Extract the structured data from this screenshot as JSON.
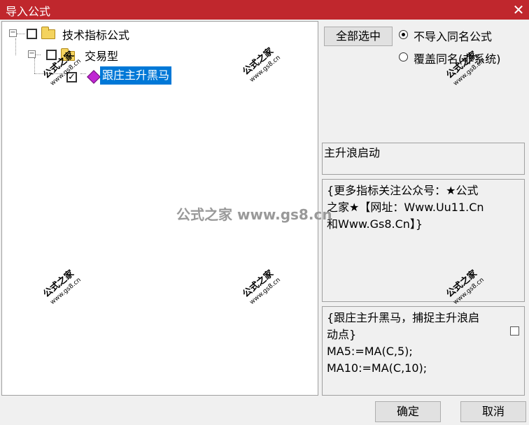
{
  "window": {
    "title": "导入公式",
    "close_glyph": "✕"
  },
  "tree": {
    "root_label": "技术指标公式",
    "group_label": "交易型",
    "item_label": "跟庄主升黑马",
    "item_checked": "✓"
  },
  "options": {
    "select_all_label": "全部选中",
    "radio_no_import": "不导入同名公式",
    "radio_overwrite": "覆盖同名(非系统)"
  },
  "panels": {
    "name_text": "主升浪启动",
    "desc_text": "{更多指标关注公众号：★公式\n之家★【网址：Www.Uu11.Cn\n和Www.Gs8.Cn】}",
    "code_text": "{跟庄主升黑马，捕捉主升浪启\n动点}\nMA5:=MA(C,5);\nMA10:=MA(C,10);"
  },
  "footer": {
    "ok_label": "确定",
    "cancel_label": "取消"
  },
  "watermark": {
    "brand": "公式之家",
    "url": "www.gs8.cn",
    "center_text": "公式之家 www.gs8.cn"
  }
}
